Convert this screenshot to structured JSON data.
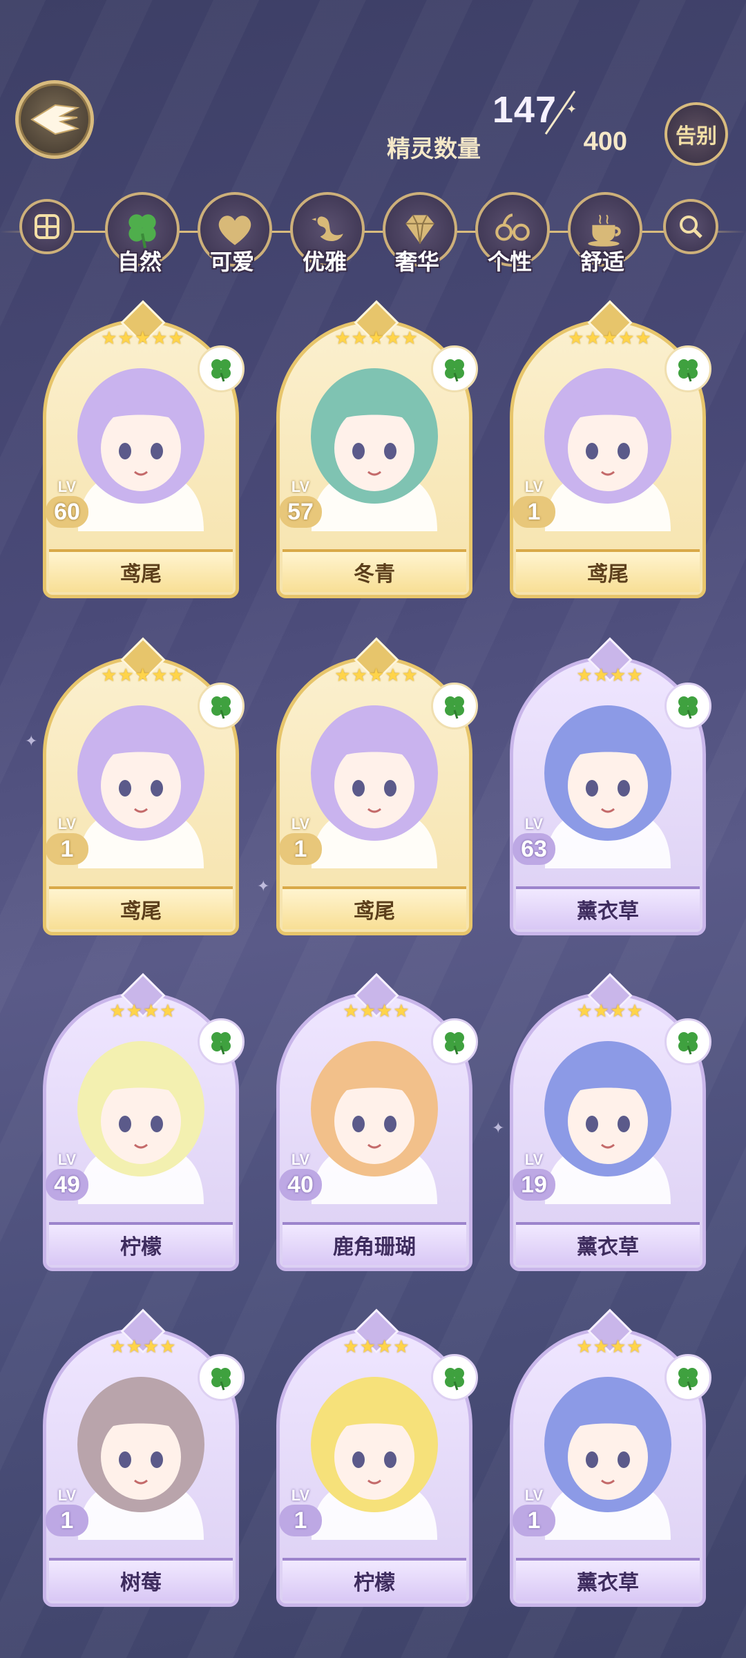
{
  "header": {
    "count_current": "147",
    "count_label": "精灵数量",
    "count_max": "400",
    "farewell_label": "告别"
  },
  "categories": [
    {
      "label": "自然",
      "icon": "clover-icon"
    },
    {
      "label": "可爱",
      "icon": "heart-icon"
    },
    {
      "label": "优雅",
      "icon": "swan-icon"
    },
    {
      "label": "奢华",
      "icon": "diamond-icon"
    },
    {
      "label": "个性",
      "icon": "glasses-icon"
    },
    {
      "label": "舒适",
      "icon": "teacup-icon"
    }
  ],
  "cards": [
    {
      "name": "鸢尾",
      "level": "60",
      "stars": "★★★★★",
      "rarity": "gold",
      "hair": "#c9b3ee"
    },
    {
      "name": "冬青",
      "level": "57",
      "stars": "★★★★★",
      "rarity": "gold",
      "hair": "#7fc3b2"
    },
    {
      "name": "鸢尾",
      "level": "1",
      "stars": "★★★★★",
      "rarity": "gold",
      "hair": "#c9b3ee"
    },
    {
      "name": "鸢尾",
      "level": "1",
      "stars": "★★★★★",
      "rarity": "gold",
      "hair": "#c9b3ee"
    },
    {
      "name": "鸢尾",
      "level": "1",
      "stars": "★★★★★",
      "rarity": "gold",
      "hair": "#c9b3ee"
    },
    {
      "name": "薰衣草",
      "level": "63",
      "stars": "★★★★",
      "rarity": "purple",
      "hair": "#8c9ae6"
    },
    {
      "name": "柠檬",
      "level": "49",
      "stars": "★★★★",
      "rarity": "purple",
      "hair": "#f3f0b0"
    },
    {
      "name": "鹿角珊瑚",
      "level": "40",
      "stars": "★★★★",
      "rarity": "purple",
      "hair": "#f2c08a"
    },
    {
      "name": "薰衣草",
      "level": "19",
      "stars": "★★★★",
      "rarity": "purple",
      "hair": "#8c9ae6"
    },
    {
      "name": "树莓",
      "level": "1",
      "stars": "★★★★",
      "rarity": "purple",
      "hair": "#b9a4ab"
    },
    {
      "name": "柠檬",
      "level": "1",
      "stars": "★★★★",
      "rarity": "purple",
      "hair": "#f6e17a"
    },
    {
      "name": "薰衣草",
      "level": "1",
      "stars": "★★★★",
      "rarity": "purple",
      "hair": "#8c9ae6"
    }
  ],
  "lv_tag": "LV"
}
